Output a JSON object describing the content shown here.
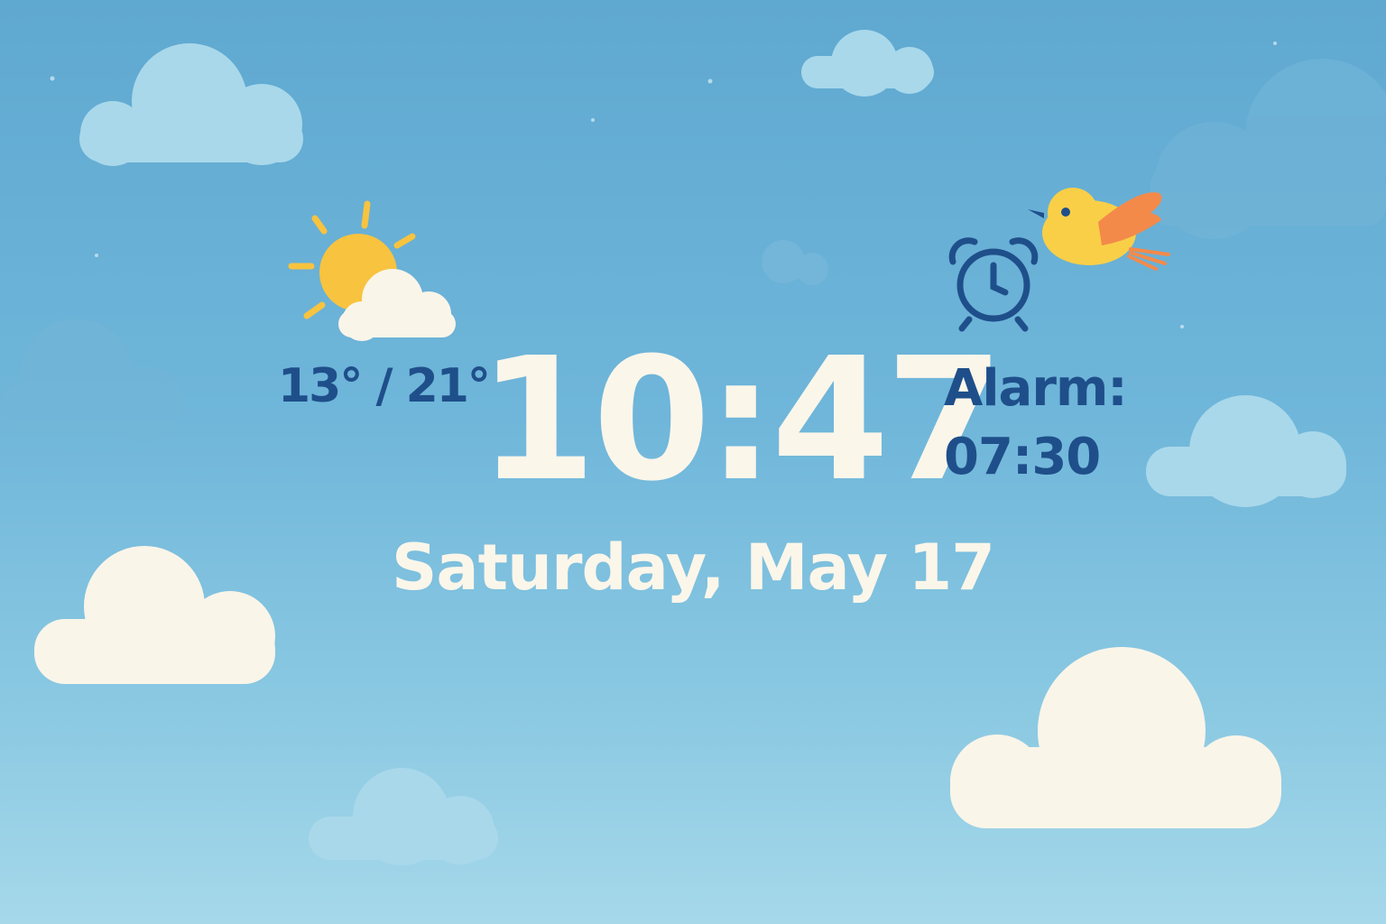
{
  "weather": {
    "icon": "partly-cloudy-icon",
    "low_high": "13° / 21°"
  },
  "clock": {
    "time": "10:47",
    "date": "Saturday, May 17"
  },
  "alarm": {
    "icon": "alarm-clock-icon",
    "label": "Alarm:",
    "time": "07:30"
  },
  "decorations": {
    "bird_icon": "bird-icon",
    "cloud_icon": "cloud-icon"
  },
  "colors": {
    "sky_top": "#5fa8d0",
    "sky_bottom": "#a6d8ea",
    "text_light": "#fbf6ea",
    "text_dark": "#1f4f8a",
    "sun": "#f8c33f",
    "bird": "#f9cf48",
    "wing": "#f48a4a"
  }
}
